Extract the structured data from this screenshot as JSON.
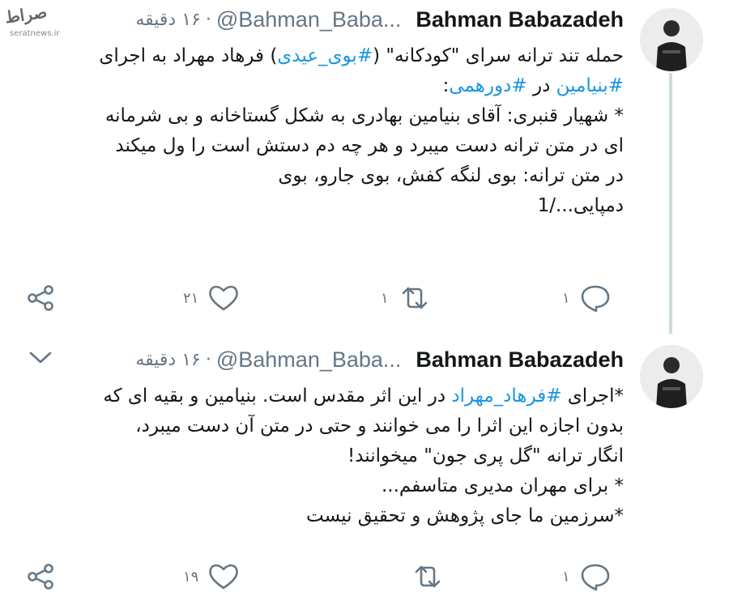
{
  "watermark": {
    "logo": "ﺻﺮﺍﻁ",
    "url": "seratnews.ir"
  },
  "tweets": [
    {
      "name": "Bahman Babazadeh",
      "handle": "@Bahman_Baba...",
      "dot": "·",
      "time": "۱۶ دقیقه",
      "lines": [
        [
          {
            "t": "حمله تند ترانه سرای \"کودکانه\" ("
          },
          {
            "t": "#بوی_عیدی",
            "h": 1
          },
          {
            "t": ") فرهاد مهراد به اجرای"
          }
        ],
        [
          {
            "t": "#بنیامین",
            "h": 1
          },
          {
            "t": " در "
          },
          {
            "t": "#دورهمی",
            "h": 1
          },
          {
            "t": ":"
          }
        ],
        [
          {
            "t": " "
          }
        ],
        [
          {
            "t": "* شهیار قنبری: آقای بنیامین بهادری به شکل گستاخانه و بی شرمانه"
          }
        ],
        [
          {
            "t": "ای در متن ترانه دست میبرد و هر چه دم دستش است را ول میکند"
          }
        ],
        [
          {
            "t": "در متن ترانه: بوی لنگه کفش، بوی جارو، بوی"
          }
        ],
        [
          {
            "t": "دمپایی.../1"
          }
        ]
      ],
      "reply_count": "۱",
      "retweet_count": "۱",
      "like_count": "۲۱"
    },
    {
      "name": "Bahman Babazadeh",
      "handle": "@Bahman_Baba...",
      "dot": "·",
      "time": "۱۶ دقیقه",
      "lines": [
        [
          {
            "t": "*اجرای "
          },
          {
            "t": "#فرهاد_مهراد",
            "h": 1
          },
          {
            "t": " در این اثر مقدس است. بنیامین و بقیه ای که"
          }
        ],
        [
          {
            "t": "بدون اجازه این اثرا را می خوانند و حتی در متن آن دست میبرد،"
          }
        ],
        [
          {
            "t": "انگار ترانه \"گل پری جون\" میخوانند!"
          }
        ],
        [
          {
            "t": "* برای مهران مدیری متاسفم..."
          }
        ],
        [
          {
            "t": "*سرزمین ما جای پژوهش و تحقیق نیست"
          }
        ]
      ],
      "reply_count": "۱",
      "retweet_count": "",
      "like_count": "۱۹"
    }
  ]
}
